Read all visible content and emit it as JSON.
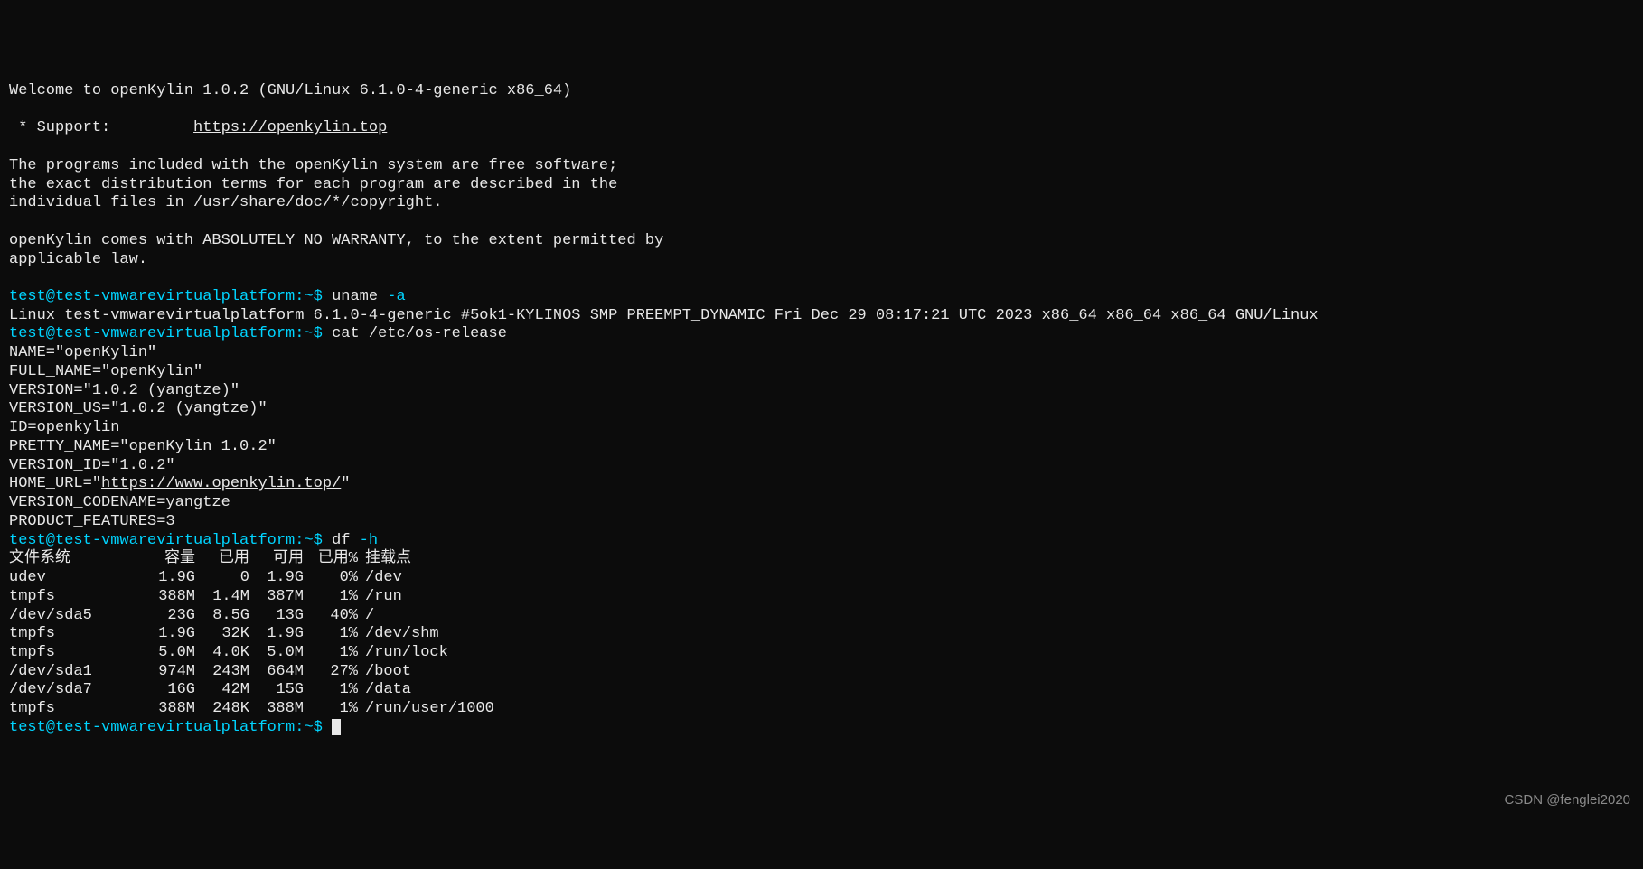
{
  "motd": {
    "welcome": "Welcome to openKylin 1.0.2 (GNU/Linux 6.1.0-4-generic x86_64)",
    "support_label": " * Support:         ",
    "support_url": "https://openkylin.top",
    "programs1": "The programs included with the openKylin system are free software;",
    "programs2": "the exact distribution terms for each program are described in the",
    "programs3": "individual files in /usr/share/doc/*/copyright.",
    "warranty1": "openKylin comes with ABSOLUTELY NO WARRANTY, to the extent permitted by",
    "warranty2": "applicable law."
  },
  "prompt1": {
    "ps1": "test@test-vmwarevirtualplatform:~$ ",
    "cmd": "uname ",
    "flag": "-a"
  },
  "uname_output": "Linux test-vmwarevirtualplatform 6.1.0-4-generic #5ok1-KYLINOS SMP PREEMPT_DYNAMIC Fri Dec 29 08:17:21 UTC 2023 x86_64 x86_64 x86_64 GNU/Linux",
  "prompt2": {
    "ps1": "test@test-vmwarevirtualplatform:~$ ",
    "cmd": "cat /etc/os-release"
  },
  "os_release": {
    "l1": "NAME=\"openKylin\"",
    "l2": "FULL_NAME=\"openKylin\"",
    "l3": "VERSION=\"1.0.2 (yangtze)\"",
    "l4": "VERSION_US=\"1.0.2 (yangtze)\"",
    "l5": "ID=openkylin",
    "l6": "PRETTY_NAME=\"openKylin 1.0.2\"",
    "l7": "VERSION_ID=\"1.0.2\"",
    "l8_prefix": "HOME_URL=\"",
    "l8_url": "https://www.openkylin.top/",
    "l8_suffix": "\"",
    "l9": "VERSION_CODENAME=yangtze",
    "l10": "PRODUCT_FEATURES=3"
  },
  "prompt3": {
    "ps1": "test@test-vmwarevirtualplatform:~$ ",
    "cmd": "df ",
    "flag": "-h"
  },
  "df": {
    "headers": [
      "文件系统",
      "容量",
      "已用",
      "可用",
      "已用%",
      "挂载点"
    ],
    "rows": [
      [
        "udev",
        "1.9G",
        "0",
        "1.9G",
        "0%",
        "/dev"
      ],
      [
        "tmpfs",
        "388M",
        "1.4M",
        "387M",
        "1%",
        "/run"
      ],
      [
        "/dev/sda5",
        "23G",
        "8.5G",
        "13G",
        "40%",
        "/"
      ],
      [
        "tmpfs",
        "1.9G",
        "32K",
        "1.9G",
        "1%",
        "/dev/shm"
      ],
      [
        "tmpfs",
        "5.0M",
        "4.0K",
        "5.0M",
        "1%",
        "/run/lock"
      ],
      [
        "/dev/sda1",
        "974M",
        "243M",
        "664M",
        "27%",
        "/boot"
      ],
      [
        "/dev/sda7",
        "16G",
        "42M",
        "15G",
        "1%",
        "/data"
      ],
      [
        "tmpfs",
        "388M",
        "248K",
        "388M",
        "1%",
        "/run/user/1000"
      ]
    ]
  },
  "prompt4": {
    "ps1": "test@test-vmwarevirtualplatform:~$ "
  },
  "watermark": "CSDN @fenglei2020"
}
